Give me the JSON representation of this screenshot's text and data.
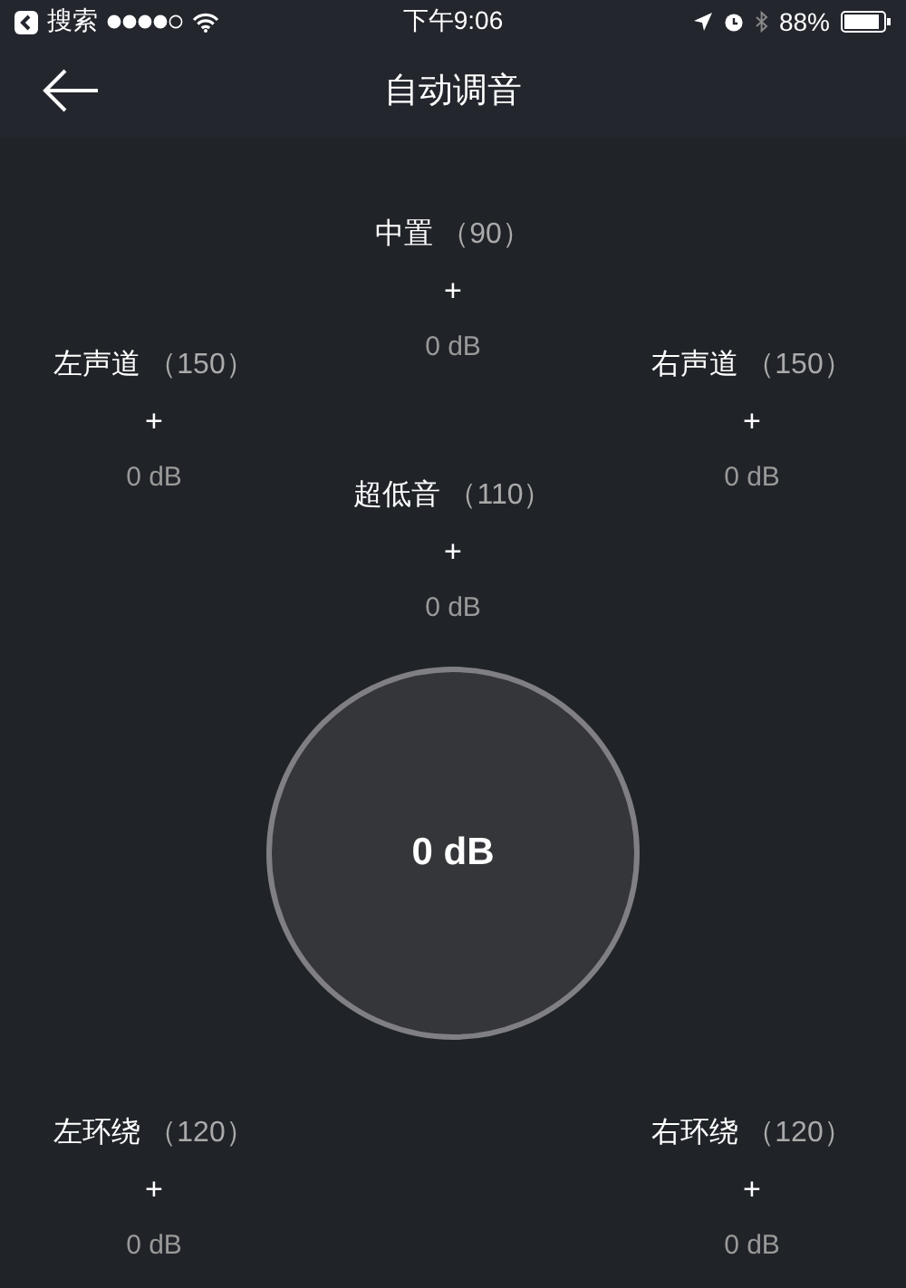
{
  "status_bar": {
    "back_app": "搜索",
    "time": "下午9:06",
    "battery": "88%"
  },
  "nav": {
    "title": "自动调音"
  },
  "speakers": {
    "center": {
      "name": "中置",
      "distance": "（90）",
      "plus": "+",
      "gain": "0 dB"
    },
    "front_left": {
      "name": "左声道",
      "distance": "（150）",
      "plus": "+",
      "gain": "0 dB"
    },
    "front_right": {
      "name": "右声道",
      "distance": "（150）",
      "plus": "+",
      "gain": "0 dB"
    },
    "subwoofer": {
      "name": "超低音",
      "distance": "（110）",
      "plus": "+",
      "gain": "0 dB"
    },
    "surround_left": {
      "name": "左环绕",
      "distance": "（120）",
      "plus": "+",
      "gain": "0 dB"
    },
    "surround_right": {
      "name": "右环绕",
      "distance": "（120）",
      "plus": "+",
      "gain": "0 dB"
    }
  },
  "master": {
    "gain": "0 dB"
  }
}
